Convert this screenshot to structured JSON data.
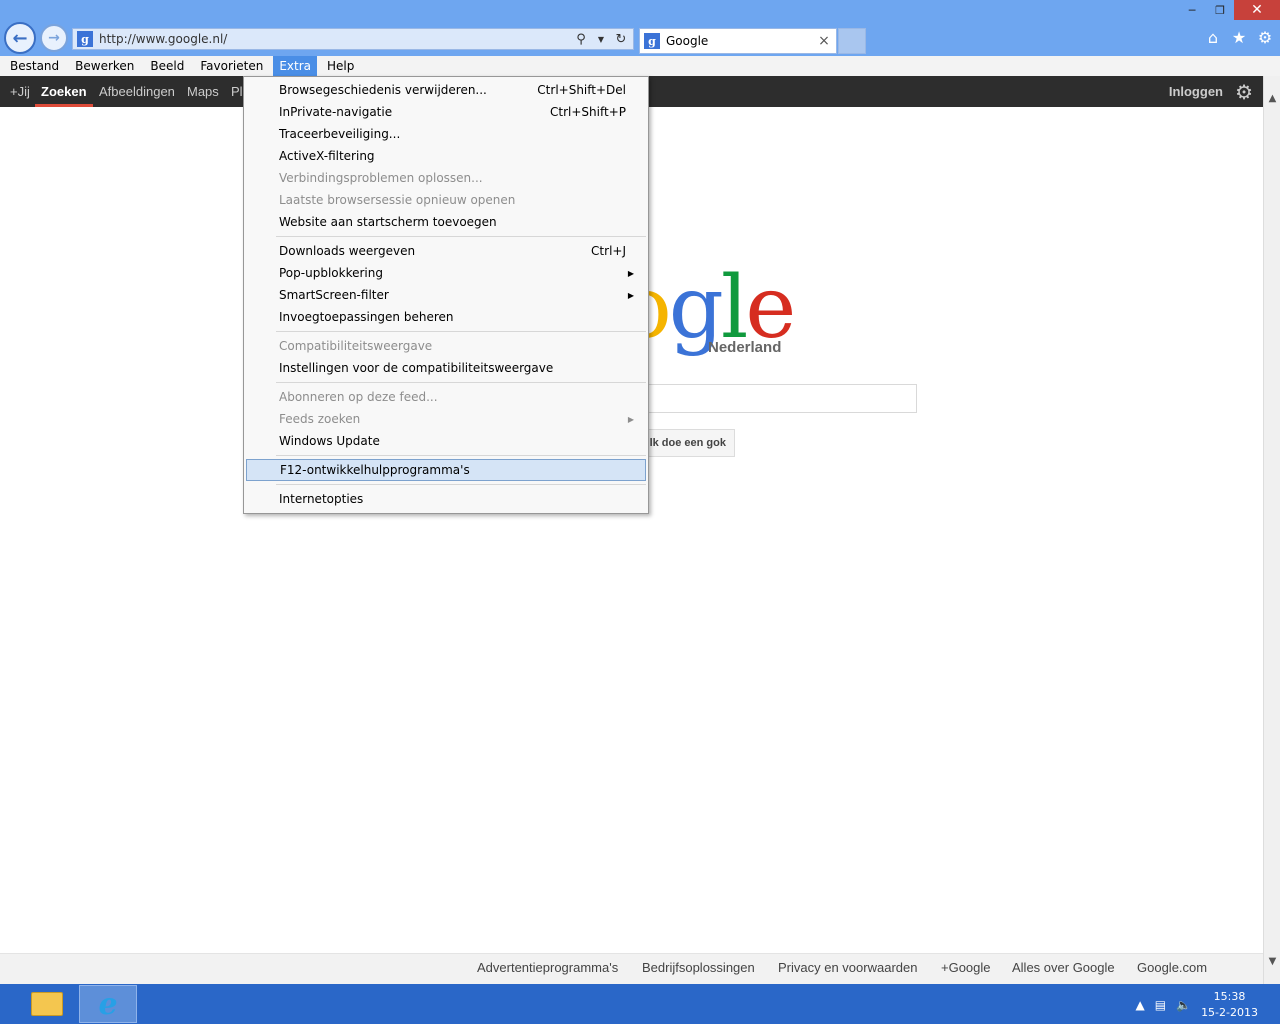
{
  "browser": {
    "url": "http://www.google.nl/",
    "tab_title": "Google",
    "tab_close": "×",
    "favicon_letter": "g"
  },
  "menubar": {
    "items": [
      "Bestand",
      "Bewerken",
      "Beeld",
      "Favorieten",
      "Extra",
      "Help"
    ],
    "active": "Extra"
  },
  "gbar": {
    "items": [
      "+Jij",
      "Zoeken",
      "Afbeeldingen",
      "Maps",
      "Pl"
    ],
    "selected": "Zoeken",
    "login": "Inloggen"
  },
  "google": {
    "logo_letters": [
      "o",
      "g",
      "l",
      "e"
    ],
    "logo_sub": "Nederland",
    "lucky_button": "lk doe een gok"
  },
  "dropdown": {
    "items": [
      {
        "label": "Browsegeschiedenis verwijderen...",
        "shortcut": "Ctrl+Shift+Del"
      },
      {
        "label": "InPrivate-navigatie",
        "shortcut": "Ctrl+Shift+P"
      },
      {
        "label": "Traceerbeveiliging...",
        "shortcut": ""
      },
      {
        "label": "ActiveX-filtering",
        "shortcut": ""
      },
      {
        "label": "Verbindingsproblemen oplossen...",
        "shortcut": "",
        "disabled": true
      },
      {
        "label": "Laatste browsersessie opnieuw openen",
        "shortcut": "",
        "disabled": true
      },
      {
        "label": "Website aan startscherm toevoegen",
        "shortcut": ""
      },
      {
        "label": "Downloads weergeven",
        "shortcut": "Ctrl+J"
      },
      {
        "label": "Pop-upblokkering",
        "shortcut": "",
        "submenu": true
      },
      {
        "label": "SmartScreen-filter",
        "shortcut": "",
        "submenu": true
      },
      {
        "label": "Invoegtoepassingen beheren",
        "shortcut": ""
      },
      {
        "label": "Compatibiliteitsweergave",
        "shortcut": "",
        "disabled": true
      },
      {
        "label": "Instellingen voor de compatibiliteitsweergave",
        "shortcut": ""
      },
      {
        "label": "Abonneren op deze feed...",
        "shortcut": "",
        "disabled": true
      },
      {
        "label": "Feeds zoeken",
        "shortcut": "",
        "disabled": true,
        "submenu": true
      },
      {
        "label": "Windows Update",
        "shortcut": ""
      },
      {
        "label": "F12-ontwikkelhulpprogramma's",
        "shortcut": "",
        "highlighted": true
      },
      {
        "label": "Internetopties",
        "shortcut": ""
      }
    ]
  },
  "footer": {
    "links": [
      "Advertentieprogramma's",
      "Bedrijfsoplossingen",
      "Privacy en voorwaarden",
      "+Google",
      "Alles over Google",
      "Google.com"
    ]
  },
  "taskbar": {
    "time": "15:38",
    "date": "15-2-2013"
  },
  "colors": {
    "titlebar": "#6ea6f0",
    "menu_active": "#4a8ee6",
    "gbar": "#2d2d2d",
    "gbar_underline": "#dd4b39",
    "taskbar": "#2a67c8",
    "close_button": "#c7413b"
  },
  "icons": [
    "back-arrow-icon",
    "forward-arrow-icon",
    "search-icon",
    "refresh-icon",
    "home-icon",
    "favorites-star-icon",
    "tools-gear-icon",
    "settings-gear-icon",
    "file-explorer-icon",
    "internet-explorer-icon",
    "network-icon",
    "volume-icon",
    "tray-expand-icon"
  ]
}
